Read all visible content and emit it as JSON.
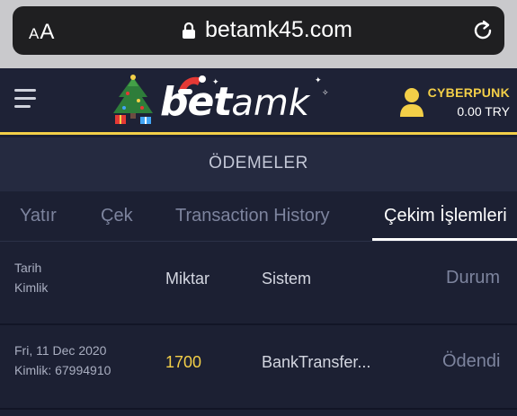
{
  "browser": {
    "font_size_label_small": "A",
    "font_size_label_large": "A",
    "url": "betamk45.com"
  },
  "header": {
    "logo_bet": "bet",
    "logo_amk": "amk",
    "username": "CYBERPUNK",
    "balance": "0.00 TRY",
    "accent_color": "#f3cf48"
  },
  "page_title": "ÖDEMELER",
  "tabs": [
    {
      "label": "Yatır",
      "active": false
    },
    {
      "label": "Çek",
      "active": false
    },
    {
      "label": "Transaction History",
      "active": false
    },
    {
      "label": "Çekim İşlemleri",
      "active": true
    }
  ],
  "table": {
    "headers": {
      "date": "Tarih",
      "id": "Kimlik",
      "amount": "Miktar",
      "system": "Sistem",
      "status": "Durum"
    },
    "rows": [
      {
        "date": "Fri, 11 Dec 2020",
        "id": "Kimlik: 67994910",
        "amount": "1700",
        "system": "BankTransfer...",
        "status": "Ödendi"
      }
    ]
  },
  "icons": {
    "menu": "hamburger-icon",
    "user": "user-icon",
    "lock": "lock-icon",
    "reload": "reload-icon",
    "tree": "christmas-tree-icon",
    "hat": "santa-hat-icon"
  }
}
